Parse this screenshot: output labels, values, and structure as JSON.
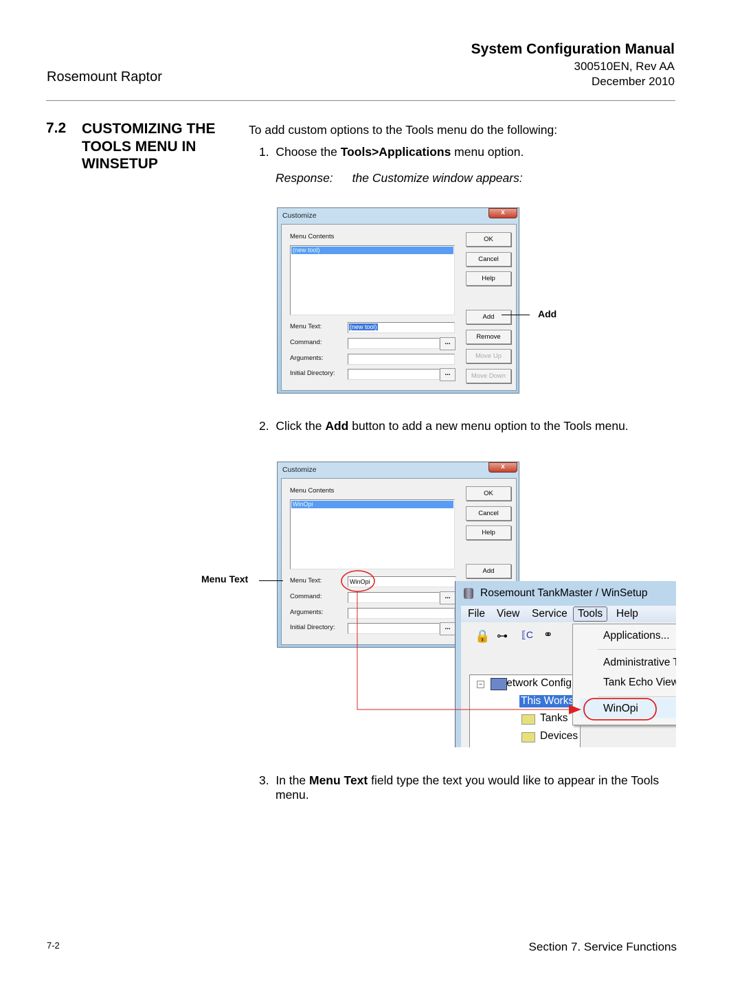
{
  "header": {
    "manual_title": "System Configuration Manual",
    "doc_number": "300510EN, Rev AA",
    "date": "December 2010",
    "product": "Rosemount Raptor"
  },
  "section": {
    "number": "7.2",
    "title": "CUSTOMIZING THE TOOLS MENU IN WINSETUP"
  },
  "intro": "To add custom options to the Tools menu do the following:",
  "steps": [
    {
      "num": "1.",
      "pre": "Choose the ",
      "bold": "Tools>Applications",
      "post": " menu option."
    },
    {
      "num": "2.",
      "pre": "Click the ",
      "bold": "Add",
      "post": " button to add a new menu option to the Tools menu."
    },
    {
      "num": "3.",
      "pre": "In the ",
      "bold": "Menu Text",
      "post": " field type the text you would like to appear in the Tools",
      "post2": "menu."
    }
  ],
  "response": {
    "label": "Response:",
    "text": "the Customize window appears:"
  },
  "dialog1": {
    "title": "Customize",
    "close": "x",
    "menu_contents": "Menu Contents",
    "list_item": "(new tool)",
    "menu_text_label": "Menu Text:",
    "menu_text_value": "(new tool)",
    "command_label": "Command:",
    "arguments_label": "Arguments:",
    "initdir_label": "Initial Directory:",
    "browse": "...",
    "buttons": {
      "ok": "OK",
      "cancel": "Cancel",
      "help": "Help",
      "add": "Add",
      "remove": "Remove",
      "move_up": "Move Up",
      "move_down": "Move Down"
    }
  },
  "dialog2": {
    "title": "Customize",
    "close": "x",
    "menu_contents": "Menu Contents",
    "list_item": "WinOpi",
    "menu_text_label": "Menu Text:",
    "menu_text_value": "WinOpi",
    "command_label": "Command:",
    "arguments_label": "Arguments:",
    "initdir_label": "Initial Directory:",
    "browse": "...",
    "buttons": {
      "ok": "OK",
      "cancel": "Cancel",
      "help": "Help",
      "add": "Add"
    }
  },
  "callouts": {
    "add": "Add",
    "menu_text": "Menu Text"
  },
  "tankmaster": {
    "title": "Rosemount TankMaster / WinSetup",
    "menu": [
      "File",
      "View",
      "Service",
      "Tools",
      "Help"
    ],
    "tools_menu": [
      "Applications...",
      "Administrative Tools",
      "Tank Echo Viewer",
      "WinOpi"
    ],
    "tree": [
      "Network Configuration",
      "This Workstation",
      "Tanks",
      "Devices"
    ]
  },
  "footer": {
    "page": "7-2",
    "section": "Section 7. Service Functions"
  },
  "colors": {
    "annotation_red": "#e02020",
    "selection_blue": "#5a9cf5"
  }
}
